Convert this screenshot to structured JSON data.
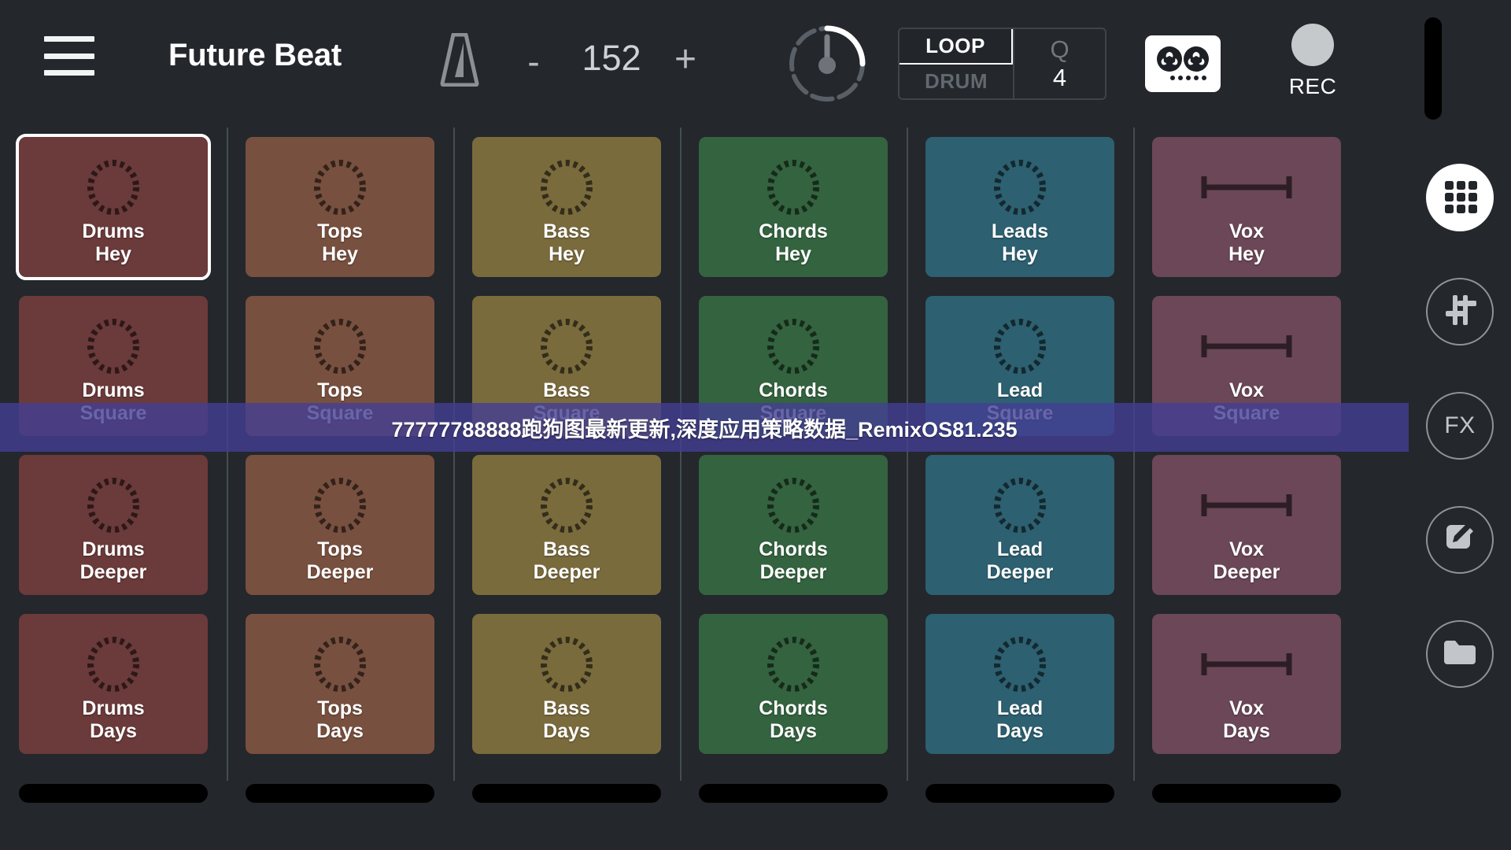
{
  "app": {
    "title": "Future Beat",
    "background_color": "#24272c"
  },
  "header": {
    "menu_icon": "hamburger-menu-icon",
    "metronome_icon": "metronome-icon",
    "tempo": {
      "decrement_label": "-",
      "value": "152",
      "increment_label": "+"
    },
    "knob_icon": "master-volume-knob",
    "loop_toggle": {
      "top_label": "LOOP",
      "bottom_label": "DRUM",
      "active": "LOOP"
    },
    "quantize": {
      "letter": "Q",
      "value": "4"
    },
    "tape_icon": "tape-recorder-icon",
    "record": {
      "icon": "record-dot-icon",
      "label": "REC"
    },
    "master_stop_icon": "master-stop-bar"
  },
  "rail": {
    "items": [
      {
        "name": "grid-view-button",
        "icon": "grid-icon",
        "label": "",
        "active": true
      },
      {
        "name": "mixer-button",
        "icon": "sliders-icon",
        "label": "",
        "active": false
      },
      {
        "name": "fx-button",
        "icon": "fx-icon",
        "label": "FX",
        "active": false
      },
      {
        "name": "edit-button",
        "icon": "edit-pencil-icon",
        "label": "",
        "active": false
      },
      {
        "name": "browse-button",
        "icon": "folder-icon",
        "label": "",
        "active": false
      }
    ]
  },
  "grid": {
    "stop_label": "",
    "columns": [
      {
        "name": "Drums",
        "color": "#6b3a3a",
        "icon": "loop-circle-icon",
        "cells": [
          {
            "line1": "Drums",
            "line2": "Hey",
            "selected": true
          },
          {
            "line1": "Drums",
            "line2": "Square",
            "selected": false
          },
          {
            "line1": "Drums",
            "line2": "Deeper",
            "selected": false
          },
          {
            "line1": "Drums",
            "line2": "Days",
            "selected": false
          }
        ]
      },
      {
        "name": "Tops",
        "color": "#78503f",
        "icon": "loop-circle-icon",
        "cells": [
          {
            "line1": "Tops",
            "line2": "Hey",
            "selected": false
          },
          {
            "line1": "Tops",
            "line2": "Square",
            "selected": false
          },
          {
            "line1": "Tops",
            "line2": "Deeper",
            "selected": false
          },
          {
            "line1": "Tops",
            "line2": "Days",
            "selected": false
          }
        ]
      },
      {
        "name": "Bass",
        "color": "#7a6b3d",
        "icon": "loop-circle-icon",
        "cells": [
          {
            "line1": "Bass",
            "line2": "Hey",
            "selected": false
          },
          {
            "line1": "Bass",
            "line2": "Square",
            "selected": false
          },
          {
            "line1": "Bass",
            "line2": "Deeper",
            "selected": false
          },
          {
            "line1": "Bass",
            "line2": "Days",
            "selected": false
          }
        ]
      },
      {
        "name": "Chords",
        "color": "#34633f",
        "icon": "loop-circle-icon",
        "cells": [
          {
            "line1": "Chords",
            "line2": "Hey",
            "selected": false
          },
          {
            "line1": "Chords",
            "line2": "Square",
            "selected": false
          },
          {
            "line1": "Chords",
            "line2": "Deeper",
            "selected": false
          },
          {
            "line1": "Chords",
            "line2": "Days",
            "selected": false
          }
        ]
      },
      {
        "name": "Leads",
        "color": "#2d6070",
        "icon": "loop-circle-icon",
        "cells": [
          {
            "line1": "Leads",
            "line2": "Hey",
            "selected": false
          },
          {
            "line1": "Lead",
            "line2": "Square",
            "selected": false
          },
          {
            "line1": "Lead",
            "line2": "Deeper",
            "selected": false
          },
          {
            "line1": "Lead",
            "line2": "Days",
            "selected": false
          }
        ]
      },
      {
        "name": "Vox",
        "color": "#6b4757",
        "icon": "one-shot-bar-icon",
        "cells": [
          {
            "line1": "Vox",
            "line2": "Hey",
            "selected": false
          },
          {
            "line1": "Vox",
            "line2": "Square",
            "selected": false
          },
          {
            "line1": "Vox",
            "line2": "Deeper",
            "selected": false
          },
          {
            "line1": "Vox",
            "line2": "Days",
            "selected": false
          }
        ]
      }
    ]
  },
  "watermark": {
    "text": "77777788888跑狗图最新更新,深度应用策略数据_RemixOS81.235",
    "band_color": "#433e94"
  }
}
